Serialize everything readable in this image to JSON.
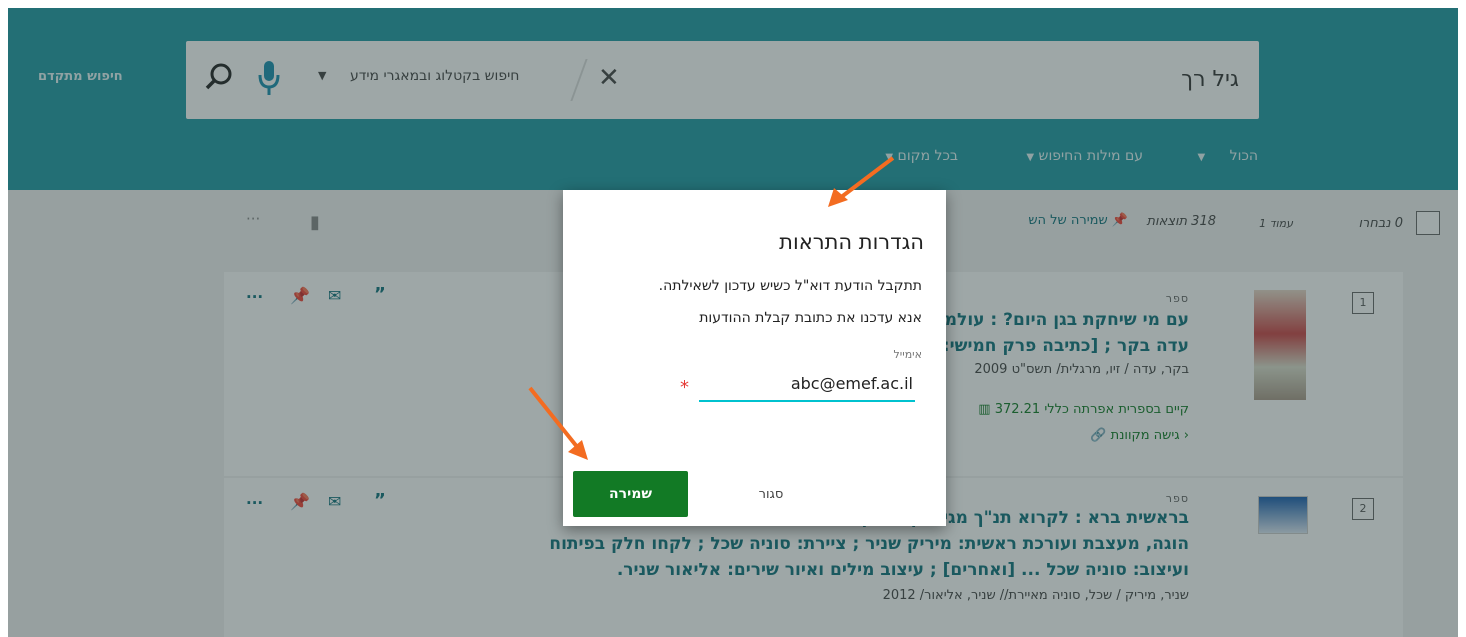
{
  "header": {
    "advanced_search": "חיפוש מתקדם",
    "search_query": "גיל רך",
    "search_scope": "חיפוש בקטלוג ובמאגרי מידע",
    "filters": [
      "הכול",
      "עם מילות החיפוש",
      "בכל מקום"
    ]
  },
  "results_bar": {
    "selected": "0 נבחרו",
    "page": "עמוד 1",
    "count": "318 תוצאות",
    "save_query": "שמירה של הש"
  },
  "results": [
    {
      "index": "1",
      "type": "ספר",
      "title_line1": "עם מי שיחקת בגן היום? : עולמם",
      "title_line2": "עדה בקר ; [כתיבה פרק חמישי: נ",
      "authors": "בקר, עדה / זיו, מרגלית/ תשס\"ט 2009",
      "availability": "קיים בספרית אפרתה  כללי  372.21",
      "online_access": "גישה מקוונת"
    },
    {
      "index": "2",
      "type": "ספר",
      "title_line1": "בראשית ברא : לקרוא תנ\"ך מגיל רך ואילך /",
      "title_line2": "הוגה, מעצבת ועורכת ראשית: מיריק שניר ; ציירת: סוניה שכל ; לקחו חלק בפיתוח",
      "title_line3": "ועיצוב: סוניה שכל ... [ואחרים] ; עיצוב מילים ואיור שירים: אליאור שניר.",
      "authors": "שניר, מיריק / שכל, סוניה מאיירת// שניר, אליאור/ 2012"
    }
  ],
  "modal": {
    "title": "הגדרות התראות",
    "line1": "תתקבל הודעת דוא\"ל כשיש עדכון לשאילתה.",
    "line2": "אנא עדכנו את כתובת קבלת ההודעות",
    "email_label": "אימייל",
    "email_value": "abc@emef.ac.il",
    "required_mark": "*",
    "save_button": "שמירה",
    "close_button": "סגור"
  },
  "colors": {
    "header": "#1f9aa5",
    "save": "#127a25",
    "annotation_arrow": "#f36c21",
    "input_underline": "#00c2cf"
  }
}
